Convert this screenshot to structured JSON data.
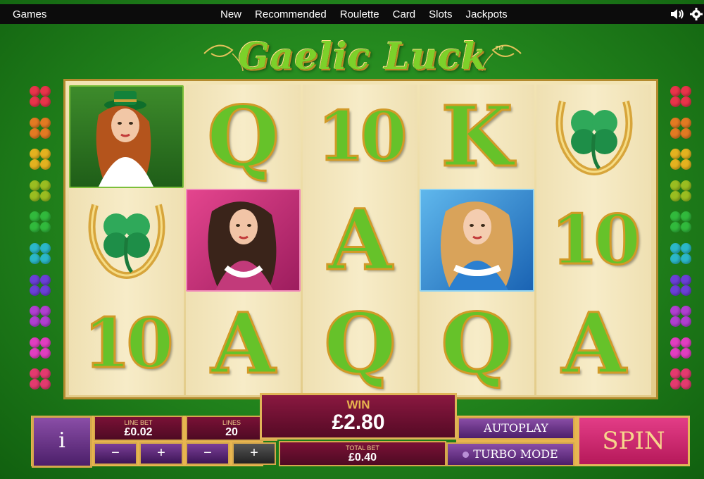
{
  "topbar": {
    "games": "Games",
    "nav": [
      "New",
      "Recommended",
      "Roulette",
      "Card",
      "Slots",
      "Jackpots"
    ],
    "icons": [
      "sound-icon",
      "gear-icon"
    ]
  },
  "logo": {
    "title": "Gaelic Luck",
    "tm": "TM"
  },
  "side_clover_colors": [
    "#e8344a",
    "#e27a22",
    "#e3b21f",
    "#99bd21",
    "#31b93c",
    "#2bb7c8",
    "#6a3fd6",
    "#b03fd0",
    "#e03ec0",
    "#e33a6f"
  ],
  "reels": [
    [
      "redhead-lady",
      "horseshoe-clover",
      "10"
    ],
    [
      "Q",
      "brunette-lady",
      "A"
    ],
    [
      "10",
      "A",
      "Q"
    ],
    [
      "K",
      "blonde-lady",
      "Q"
    ],
    [
      "horseshoe-clover",
      "10",
      "A"
    ]
  ],
  "controls": {
    "info": "i",
    "line_bet_label": "LINE BET",
    "line_bet": "£0.02",
    "lines_label": "LINES",
    "lines": "20",
    "minus": "−",
    "plus": "+",
    "win_label": "WIN",
    "win": "£2.80",
    "total_bet_label": "TOTAL BET",
    "total_bet": "£0.40",
    "autoplay": "AUTOPLAY",
    "turbo": "TURBO MODE",
    "spin": "SPIN"
  }
}
